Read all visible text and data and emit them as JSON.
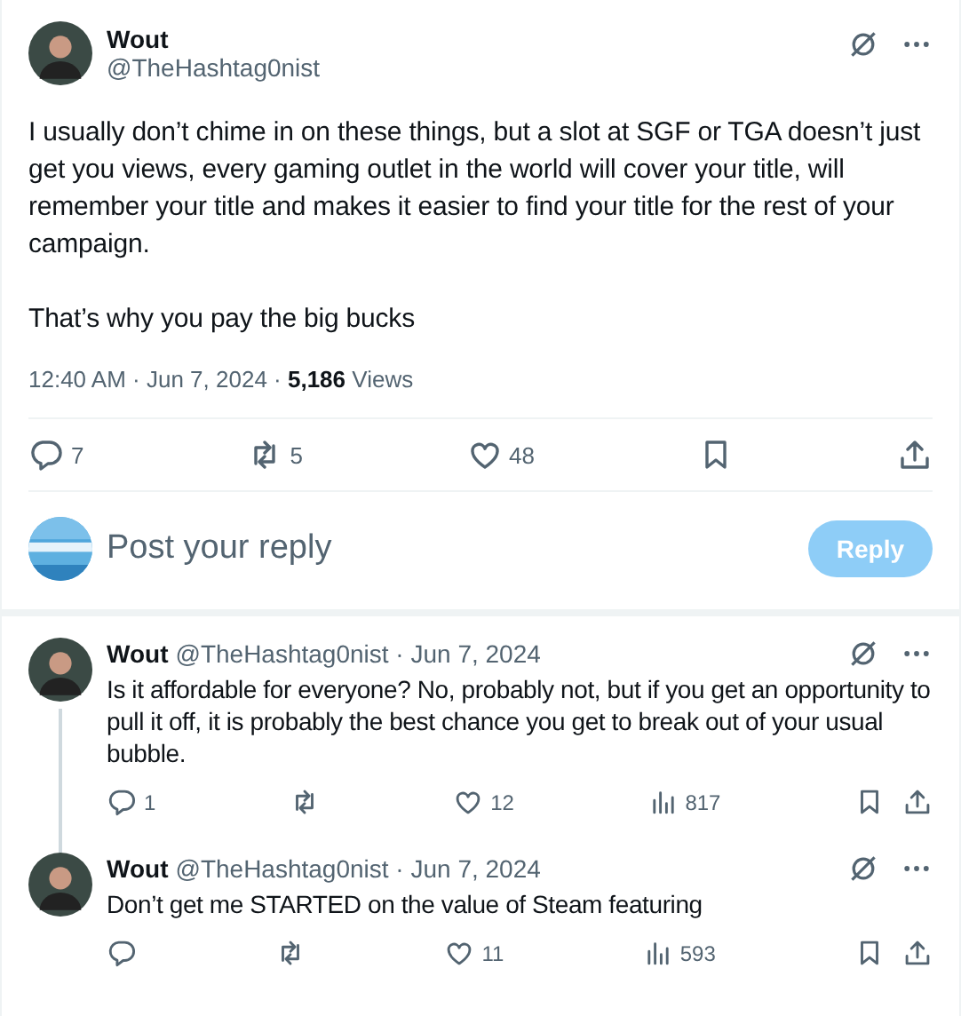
{
  "main_post": {
    "author": {
      "name": "Wout",
      "handle": "@TheHashtag0nist"
    },
    "paragraphs": [
      "I usually don’t chime in on these things, but a slot at SGF or TGA doesn’t just get you views, every gaming outlet in the world will cover your title, will remember your title and makes it easier to find your title for the rest of your campaign.",
      "That’s why you pay the big bucks"
    ],
    "meta": "12:40 AM · Jun 7, 2024 · **5,186** Views",
    "actions": [
      {
        "kind": "reply",
        "count": "7"
      },
      {
        "kind": "repost",
        "count": "5"
      },
      {
        "kind": "like",
        "count": "48"
      },
      {
        "kind": "bookmark"
      },
      {
        "kind": "share"
      }
    ]
  },
  "composer": {
    "placeholder": "Post your reply",
    "button": {
      "label": "Reply",
      "disabled": true
    }
  },
  "replies": [
    {
      "name": "Wout",
      "byline": "@TheHashtag0nist · Jun 7, 2024",
      "text": "Is it affordable for everyone? No, probably not, but if you get an opportunity to pull it off, it is probably the best chance you get to break out of your usual bubble.",
      "thread_line": true,
      "actions": [
        {
          "kind": "reply",
          "count": "1"
        },
        {
          "kind": "repost"
        },
        {
          "kind": "like",
          "count": "12"
        },
        {
          "kind": "views",
          "count": "817"
        },
        {
          "kind": "bookmark"
        },
        {
          "kind": "share"
        }
      ]
    },
    {
      "name": "Wout",
      "byline": "@TheHashtag0nist · Jun 7, 2024",
      "text": "Don’t get me STARTED on the value of Steam featuring",
      "thread_line": false,
      "actions": [
        {
          "kind": "reply"
        },
        {
          "kind": "repost"
        },
        {
          "kind": "like",
          "count": "11"
        },
        {
          "kind": "views",
          "count": "593"
        },
        {
          "kind": "bookmark"
        },
        {
          "kind": "share"
        }
      ]
    }
  ]
}
